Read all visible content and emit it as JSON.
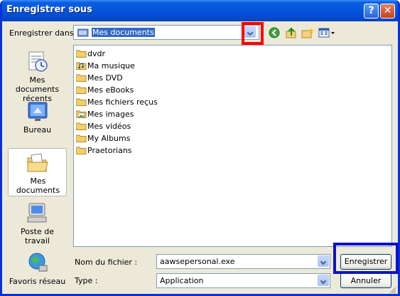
{
  "window": {
    "title": "Enregistrer sous",
    "help_glyph": "?",
    "close_glyph": "✕"
  },
  "save_in": {
    "label": "Enregistrer dans :",
    "value": "Mes documents"
  },
  "toolbar": {
    "icons": [
      "back-icon",
      "up-folder-icon",
      "new-folder-icon",
      "view-menu-icon"
    ]
  },
  "places": [
    {
      "label": "Mes documents récents",
      "icon": "recent-documents-icon"
    },
    {
      "label": "Bureau",
      "icon": "desktop-icon"
    },
    {
      "label": "Mes documents",
      "icon": "my-documents-icon",
      "active": true
    },
    {
      "label": "Poste de travail",
      "icon": "my-computer-icon"
    },
    {
      "label": "Favoris réseau",
      "icon": "network-places-icon"
    }
  ],
  "files": [
    {
      "name": "dvdr",
      "icon": "folder-icon"
    },
    {
      "name": "Ma musique",
      "icon": "music-folder-icon"
    },
    {
      "name": "Mes DVD",
      "icon": "folder-icon"
    },
    {
      "name": "Mes eBooks",
      "icon": "folder-icon"
    },
    {
      "name": "Mes fichiers reçus",
      "icon": "folder-icon"
    },
    {
      "name": "Mes images",
      "icon": "pictures-folder-icon"
    },
    {
      "name": "Mes vidéos",
      "icon": "folder-icon"
    },
    {
      "name": "My Albums",
      "icon": "folder-icon"
    },
    {
      "name": "Praetorians",
      "icon": "folder-icon"
    }
  ],
  "filename": {
    "label": "Nom du fichier :",
    "value": "aawsepersonal.exe"
  },
  "filetype": {
    "label": "Type :",
    "value": "Application"
  },
  "buttons": {
    "save": "Enregistrer",
    "cancel": "Annuler"
  },
  "colors": {
    "title_bar": "#0555dc",
    "dialog_bg": "#ece9d8",
    "selection": "#316ac5",
    "highlight_red": "#ff0000",
    "highlight_blue": "#1010c8"
  }
}
